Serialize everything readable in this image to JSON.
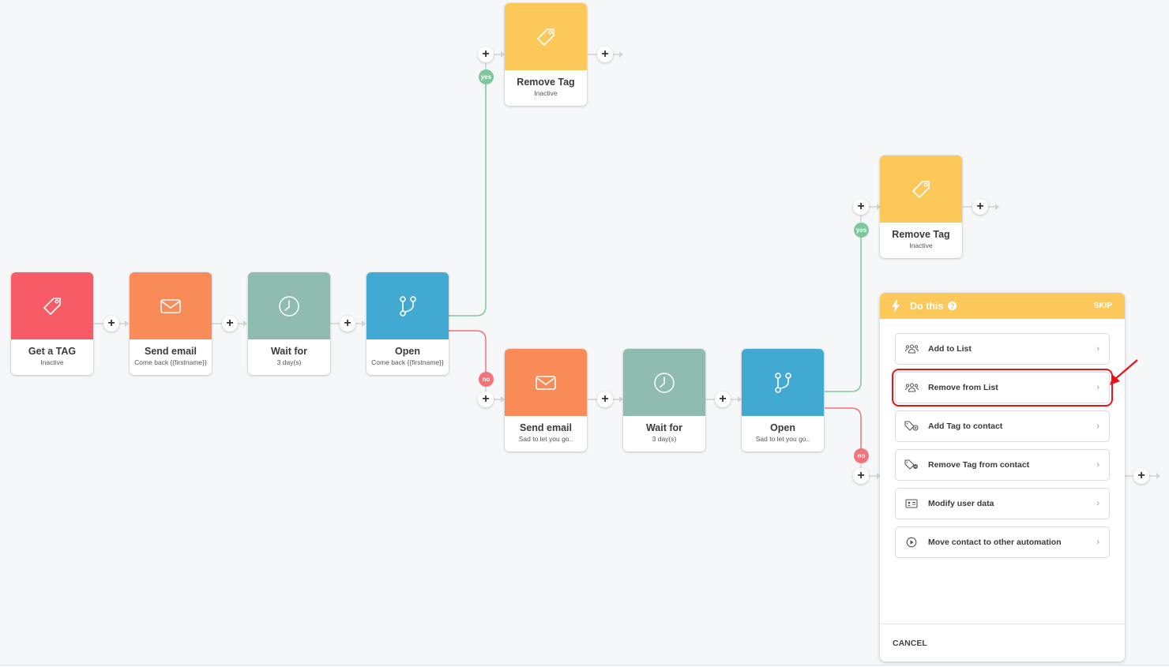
{
  "colors": {
    "trigger": "#f75b66",
    "email": "#f98b59",
    "wait": "#8fbbb0",
    "condition": "#41a9d2",
    "tag": "#fcc85a",
    "yes": "#7dc79a",
    "no": "#f2747a",
    "highlight": "#e5141b"
  },
  "nodes": [
    {
      "id": "get-tag",
      "type": "trigger",
      "icon": "tag-icon",
      "title": "Get a TAG",
      "subtitle": "Inactive"
    },
    {
      "id": "send-email-1",
      "type": "email",
      "icon": "envelope-icon",
      "title": "Send email",
      "subtitle": "Come back {{firstname}}"
    },
    {
      "id": "wait-1",
      "type": "wait",
      "icon": "clock-icon",
      "title": "Wait for",
      "subtitle": "3 day(s)"
    },
    {
      "id": "open-1",
      "type": "condition",
      "icon": "branch-icon",
      "title": "Open",
      "subtitle": "Come back {{firstname}}"
    },
    {
      "id": "remove-tag-1",
      "type": "tag",
      "icon": "tag-icon",
      "title": "Remove Tag",
      "subtitle": "Inactive"
    },
    {
      "id": "send-email-2",
      "type": "email",
      "icon": "envelope-icon",
      "title": "Send email",
      "subtitle": "Sad to let you go.."
    },
    {
      "id": "wait-2",
      "type": "wait",
      "icon": "clock-icon",
      "title": "Wait for",
      "subtitle": "3 day(s)"
    },
    {
      "id": "open-2",
      "type": "condition",
      "icon": "branch-icon",
      "title": "Open",
      "subtitle": "Sad to let you go.."
    },
    {
      "id": "remove-tag-2",
      "type": "tag",
      "icon": "tag-icon",
      "title": "Remove Tag",
      "subtitle": "Inactive"
    }
  ],
  "badges": {
    "yes": "yes",
    "no": "no"
  },
  "add_step_symbol": "+",
  "panel": {
    "title": "Do this",
    "help_symbol": "?",
    "skip_label": "SKIP",
    "options": [
      {
        "label": "Add to List",
        "icon": "users-icon"
      },
      {
        "label": "Remove from List",
        "icon": "users-icon",
        "highlighted": true
      },
      {
        "label": "Add Tag to contact",
        "icon": "tag-add-icon"
      },
      {
        "label": "Remove Tag from contact",
        "icon": "tag-remove-icon"
      },
      {
        "label": "Modify user data",
        "icon": "id-card-icon"
      },
      {
        "label": "Move contact to other automation",
        "icon": "play-circle-icon"
      }
    ],
    "chevron": "›",
    "cancel_label": "CANCEL"
  }
}
